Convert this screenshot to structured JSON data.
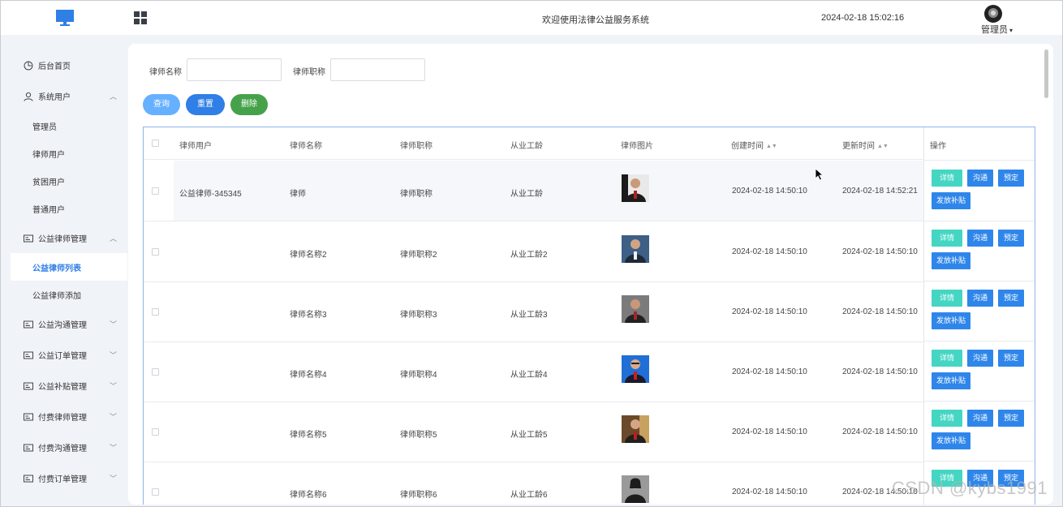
{
  "header": {
    "title": "欢迎使用法律公益服务系统",
    "datetime": "2024-02-18 15:02:16",
    "user": "管理员"
  },
  "sidebar": {
    "items": [
      {
        "label": "后台首页",
        "icon": "clock-icon"
      },
      {
        "label": "系统用户",
        "icon": "user-icon",
        "arrow": "up"
      },
      {
        "label": "管理员",
        "sub": true
      },
      {
        "label": "律师用户",
        "sub": true
      },
      {
        "label": "贫困用户",
        "sub": true
      },
      {
        "label": "普通用户",
        "sub": true
      },
      {
        "label": "公益律师管理",
        "icon": "card-icon",
        "arrow": "up"
      },
      {
        "label": "公益律师列表",
        "sub": true,
        "active": true
      },
      {
        "label": "公益律师添加",
        "sub": true
      },
      {
        "label": "公益沟通管理",
        "icon": "card-icon",
        "arrow": "down"
      },
      {
        "label": "公益订单管理",
        "icon": "card-icon",
        "arrow": "down"
      },
      {
        "label": "公益补贴管理",
        "icon": "card-icon",
        "arrow": "down"
      },
      {
        "label": "付费律师管理",
        "icon": "card-icon",
        "arrow": "down"
      },
      {
        "label": "付费沟通管理",
        "icon": "card-icon",
        "arrow": "down"
      },
      {
        "label": "付费订单管理",
        "icon": "card-icon",
        "arrow": "down"
      }
    ]
  },
  "filters": {
    "name_label": "律师名称",
    "name_value": "",
    "title_label": "律师职称",
    "title_value": ""
  },
  "actions": {
    "query": "查询",
    "reset": "重置",
    "delete": "删除"
  },
  "table": {
    "columns": [
      "律师用户",
      "律师名称",
      "律师职称",
      "从业工龄",
      "律师图片",
      "创建时间",
      "更新时间",
      "操作"
    ],
    "row_buttons": {
      "detail": "详情",
      "chat": "沟通",
      "book": "预定",
      "subsidy": "发放补贴"
    },
    "rows": [
      {
        "user": "公益律师-345345",
        "name": "律师",
        "title": "律师职称",
        "years": "从业工龄",
        "created": "2024-02-18 14:50:10",
        "updated": "2024-02-18 14:52:21"
      },
      {
        "user": "",
        "name": "律师名称2",
        "title": "律师职称2",
        "years": "从业工龄2",
        "created": "2024-02-18 14:50:10",
        "updated": "2024-02-18 14:50:10"
      },
      {
        "user": "",
        "name": "律师名称3",
        "title": "律师职称3",
        "years": "从业工龄3",
        "created": "2024-02-18 14:50:10",
        "updated": "2024-02-18 14:50:10"
      },
      {
        "user": "",
        "name": "律师名称4",
        "title": "律师职称4",
        "years": "从业工龄4",
        "created": "2024-02-18 14:50:10",
        "updated": "2024-02-18 14:50:10"
      },
      {
        "user": "",
        "name": "律师名称5",
        "title": "律师职称5",
        "years": "从业工龄5",
        "created": "2024-02-18 14:50:10",
        "updated": "2024-02-18 14:50:10"
      },
      {
        "user": "",
        "name": "律师名称6",
        "title": "律师职称6",
        "years": "从业工龄6",
        "created": "2024-02-18 14:50:10",
        "updated": "2024-02-18 14:50:10"
      }
    ]
  },
  "watermark": "CSDN @kybs1991",
  "colors": {
    "primary": "#2f7fe6",
    "query": "#66b1ff",
    "reset": "#2f7fe6",
    "delete": "#46a24a",
    "detail": "#44d6c3",
    "action_blue": "#2f86ea"
  }
}
